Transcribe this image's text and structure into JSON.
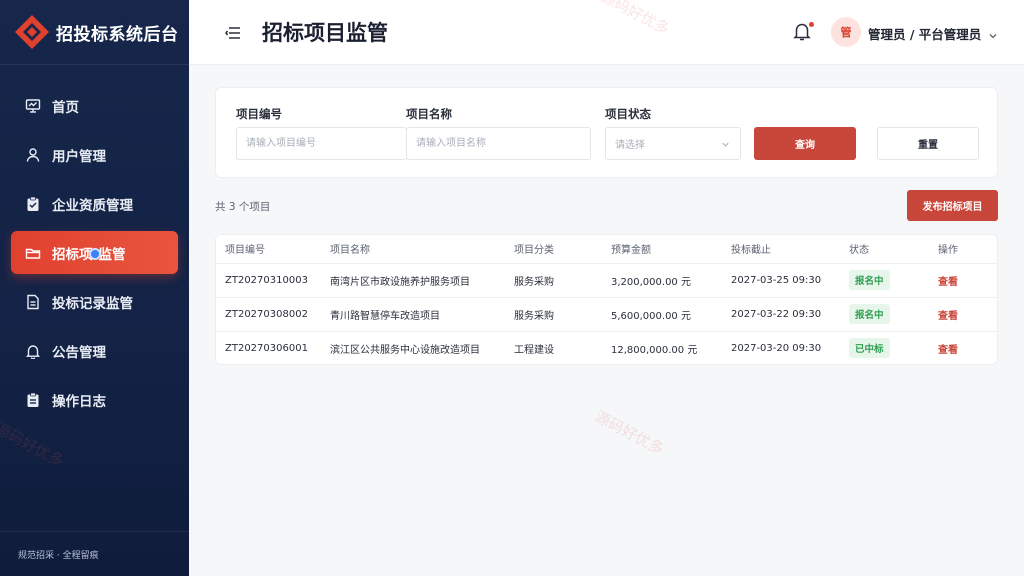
{
  "brand": {
    "title": "招投标系统后台"
  },
  "sidebar": {
    "items": [
      {
        "label": "首页",
        "icon": "chart-board-icon",
        "active": false
      },
      {
        "label": "用户管理",
        "icon": "user-icon",
        "active": false
      },
      {
        "label": "企业资质管理",
        "icon": "clipboard-check-icon",
        "active": false
      },
      {
        "label": "招标项目监管",
        "icon": "folder-icon",
        "active": true
      },
      {
        "label": "投标记录监管",
        "icon": "document-icon",
        "active": false
      },
      {
        "label": "公告管理",
        "icon": "bell-icon",
        "active": false
      },
      {
        "label": "操作日志",
        "icon": "clipboard-list-icon",
        "active": false
      }
    ],
    "active_label_prefix": "招标项",
    "active_label_suffix": "监管",
    "footer": "规范招采 · 全程留痕"
  },
  "header": {
    "title": "招标项目监管",
    "avatar_text": "管",
    "user_name": "管理员 / 平台管理员"
  },
  "filters": {
    "code_label": "项目编号",
    "code_placeholder": "请输入项目编号",
    "name_label": "项目名称",
    "name_placeholder": "请输入项目名称",
    "status_label": "项目状态",
    "status_placeholder": "请选择",
    "query_button": "查询",
    "reset_button": "重置"
  },
  "summary": {
    "count_text": "共 3 个项目",
    "publish_button": "发布招标项目"
  },
  "table": {
    "columns": [
      "项目编号",
      "项目名称",
      "项目分类",
      "预算金额",
      "投标截止",
      "状态",
      "操作"
    ],
    "rows": [
      {
        "code": "ZT20270310003",
        "name": "南湾片区市政设施养护服务项目",
        "category": "服务采购",
        "budget": "3,200,000.00 元",
        "deadline": "2027-03-25 09:30",
        "status": "报名中",
        "action": "查看"
      },
      {
        "code": "ZT20270308002",
        "name": "青川路智慧停车改造项目",
        "category": "服务采购",
        "budget": "5,600,000.00 元",
        "deadline": "2027-03-22 09:30",
        "status": "报名中",
        "action": "查看"
      },
      {
        "code": "ZT20270306001",
        "name": "滨江区公共服务中心设施改造项目",
        "category": "工程建设",
        "budget": "12,800,000.00 元",
        "deadline": "2027-03-20 09:30",
        "status": "已中标",
        "action": "查看"
      }
    ]
  },
  "watermark": {
    "text": "源码好优多"
  },
  "colors": {
    "accent": "#c9463a",
    "sidebar_bg": "#16274b",
    "active_nav": "#e0412f",
    "badge_bg": "#e7f6ea",
    "badge_text": "#2f9e52"
  }
}
